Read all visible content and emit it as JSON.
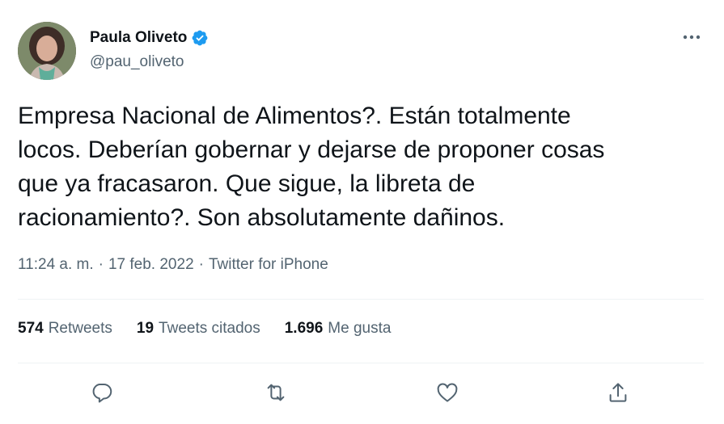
{
  "author": {
    "display_name": "Paula Oliveto",
    "handle": "@pau_oliveto",
    "verified": true
  },
  "tweet": {
    "text_lines": [
      "Empresa Nacional de Alimentos?. Están totalmente",
      "locos. Deberían gobernar y dejarse de proponer cosas",
      "que ya fracasaron. Que sigue, la libreta de",
      "racionamiento?. Son absolutamente dañinos."
    ],
    "time": "11:24 a. m.",
    "separator": "·",
    "date": "17 feb. 2022",
    "source": "Twitter for iPhone"
  },
  "stats": {
    "retweets": {
      "count": "574",
      "label": "Retweets"
    },
    "quotes": {
      "count": "19",
      "label": "Tweets citados"
    },
    "likes": {
      "count": "1.696",
      "label": "Me gusta"
    }
  },
  "icons": {
    "more": "more-dots-icon",
    "verified": "verified-badge-icon",
    "reply": "reply-icon",
    "retweet": "retweet-icon",
    "like": "heart-icon",
    "share": "share-icon"
  },
  "colors": {
    "text": "#0f1419",
    "secondary": "#536471",
    "verified": "#1d9bf0",
    "divider": "#eff3f4"
  }
}
